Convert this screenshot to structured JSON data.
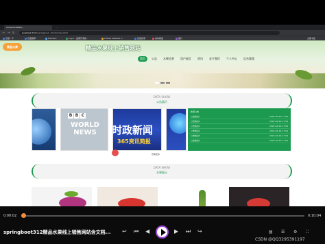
{
  "browser": {
    "tabs": [
      {
        "label": "localhost:8080/..."
      },
      {
        "label": "..."
      }
    ],
    "url_host": "localhost",
    "url_path": ":8080/springboot.../front/index.html",
    "bookmarks": [
      "百度一下",
      "百度翻译",
      "Element",
      "Layui - 经典开源模...",
      "HTML5 Website T...",
      "百度搜索",
      "素材模板",
      "图片",
      "全部书签"
    ]
  },
  "site": {
    "logo": "精品水果",
    "title": "精品水果线上销售网站",
    "menu": [
      "首页",
      "公告",
      "水果信息",
      "用户留言",
      "资讯",
      "关于我们",
      "个人中心",
      "后台管理"
    ],
    "active_menu_index": 0
  },
  "news_section": {
    "en": "DATA SHOW",
    "cn": "公告展示",
    "bbc_letters": [
      "B",
      "B",
      "C"
    ],
    "img_b_text": "WORLD NEWS",
    "img_c_line1": "时政新闻",
    "img_c_line2": "365资讯简报",
    "list_header": "新闻公告",
    "list": [
      {
        "title": "公告信息1",
        "date": "2022-04-16 17:09"
      },
      {
        "title": "公告信息2",
        "date": "2022-04-16 17:09"
      },
      {
        "title": "公告信息3",
        "date": "2022-04-16 17:09"
      },
      {
        "title": "公告信息4",
        "date": "2022-04-16 17:09"
      },
      {
        "title": "公告信息5",
        "date": "2022-04-16 17:09"
      },
      {
        "title": "公告信息6",
        "date": "2022-04-16 17:09"
      }
    ],
    "more": "查看更多"
  },
  "product_section": {
    "en": "DATA SHOW",
    "cn": "水果展示"
  },
  "player": {
    "current": "0:00:02",
    "total": "0:10:04",
    "progress": 0.003,
    "title": "springboot312精品水果线上销售网站含文档...",
    "watermark": "CSDN @QQ3295391197"
  }
}
